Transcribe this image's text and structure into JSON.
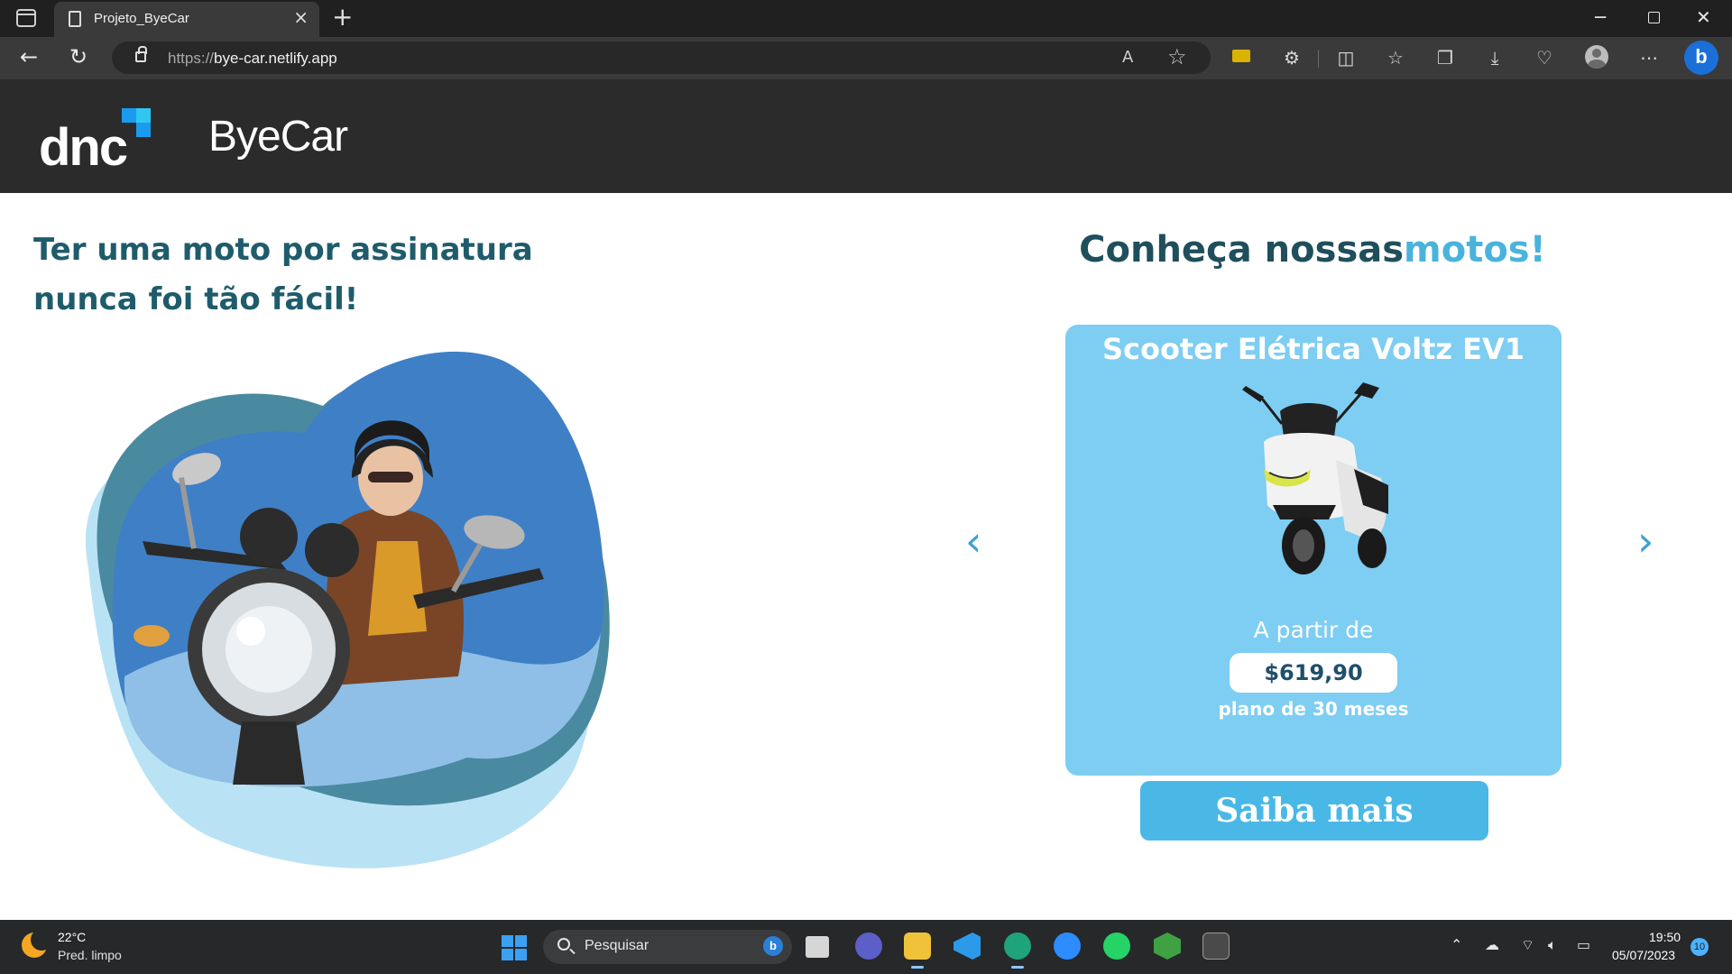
{
  "browser": {
    "tab_title": "Projeto_ByeCar",
    "url_protocol": "https://",
    "url_host": "bye-car.netlify.app",
    "new_tab_symbol": "+",
    "close_symbol": "×"
  },
  "site": {
    "brand": "ByeCar",
    "logo_text": "dnc",
    "hero": {
      "part1": "Ter ",
      "bold": "uma moto",
      "part2": " por assinatura nunca foi tão fácil!"
    },
    "section_title": "Conheça nossas",
    "section_title_highlight": "motos!",
    "carousel": {
      "prev_symbol": "‹",
      "next_symbol": "›",
      "card": {
        "title": "Scooter Elétrica Voltz EV1",
        "from_label": "A partir de",
        "price": "$619,90",
        "plan": "plano de 30 meses"
      }
    },
    "cta_label": "Saiba mais"
  },
  "taskbar": {
    "weather_temp": "22°C",
    "weather_desc": "Pred. limpo",
    "search_label": "Pesquisar",
    "time": "19:50",
    "date": "05/07/2023",
    "notifications": "10"
  },
  "colors": {
    "header_bg": "#2b2b2b",
    "card_bg": "#7ecdf2",
    "cta_bg": "#4ab8e6",
    "title_dark": "#1f5c6b",
    "title_highlight": "#4ab3dc",
    "arrow": "#3f9fd6"
  }
}
